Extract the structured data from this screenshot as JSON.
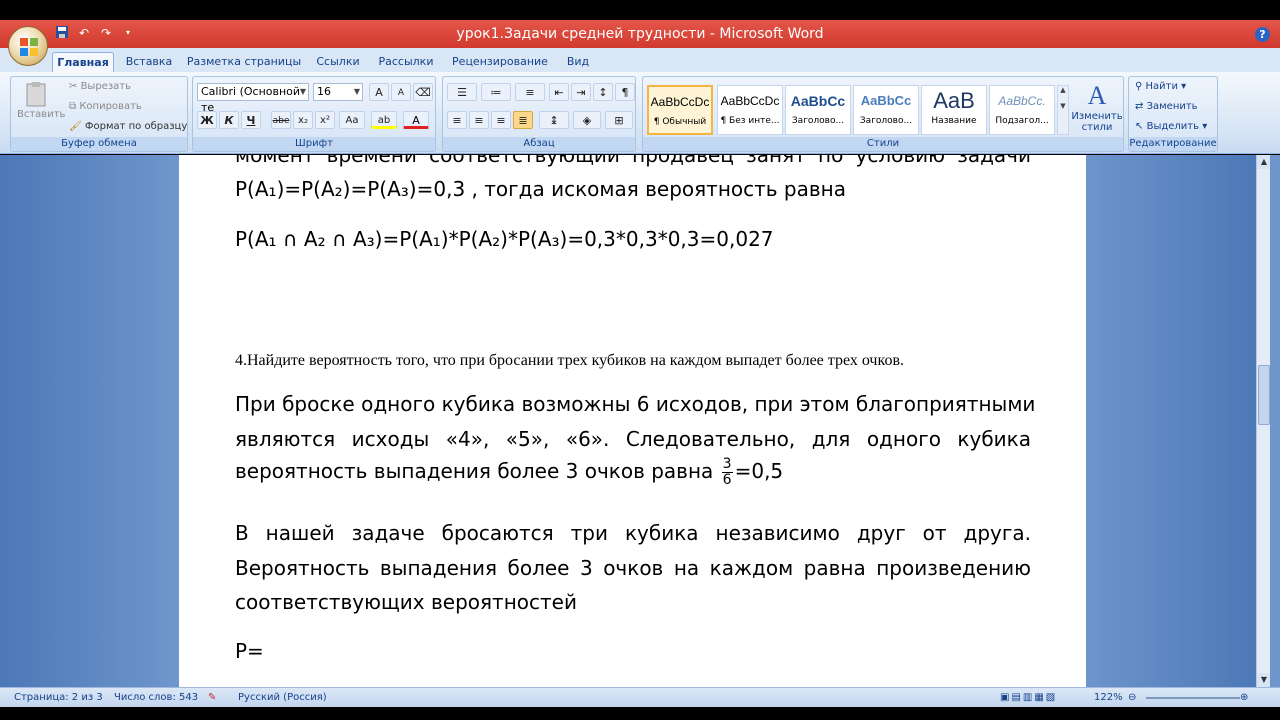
{
  "window": {
    "title": "урок1.Задачи средней трудности - Microsoft Word",
    "help_glyph": "?",
    "qat_icons": [
      "save-icon",
      "undo-icon",
      "redo-icon",
      "customize-icon"
    ]
  },
  "tabs": [
    {
      "label": "Главная",
      "active": true
    },
    {
      "label": "Вставка"
    },
    {
      "label": "Разметка страницы"
    },
    {
      "label": "Ссылки"
    },
    {
      "label": "Рассылки"
    },
    {
      "label": "Рецензирование"
    },
    {
      "label": "Вид"
    }
  ],
  "ribbon": {
    "clipboard": {
      "label": "Буфер обмена",
      "paste": "Вставить",
      "cut": "Вырезать",
      "copy": "Копировать",
      "format_painter": "Формат по образцу"
    },
    "font": {
      "label": "Шрифт",
      "font_name": "Calibri (Основной те",
      "font_size": "16",
      "bold": "Ж",
      "italic": "К",
      "underline": "Ч",
      "strike": "abe",
      "subscript": "x₂",
      "superscript": "x²",
      "change_case": "Aa",
      "grow": "A",
      "shrink": "A",
      "highlight": "ab",
      "font_color": "A"
    },
    "paragraph": {
      "label": "Абзац"
    },
    "styles": {
      "label": "Стили",
      "items": [
        {
          "sample": "AaBbCcDc",
          "name": "¶ Обычный",
          "selected": true
        },
        {
          "sample": "AaBbCcDc",
          "name": "¶ Без инте..."
        },
        {
          "sample": "AaBbCc",
          "name": "Заголово..."
        },
        {
          "sample": "AaBbCc",
          "name": "Заголово..."
        },
        {
          "sample": "AaB",
          "name": "Название"
        },
        {
          "sample": "AaBbCc.",
          "name": "Подзагол..."
        }
      ],
      "change_styles": "Изменить стили"
    },
    "editing": {
      "label": "Редактирование",
      "find": "Найти",
      "replace": "Заменить",
      "select": "Выделить"
    }
  },
  "document": {
    "line_cut": "момент времени соответствующий продавец занят по условию задачи",
    "line1": "P(A₁)=P(A₂)=P(A₃)=0,3 , тогда искомая вероятность равна",
    "line2": "P(A₁ ∩ A₂ ∩ A₃)=P(A₁)*P(A₂)*P(A₃)=0,3*0,3*0,3=0,027",
    "task4": "4.Найдите вероятность того, что при бросании трех кубиков на каждом выпадет более трех очков.",
    "p1_l1": "При броске одного кубика возможны 6 исходов, при этом благоприятными",
    "p1_l2": "являются исходы «4», «5», «6». Следовательно, для одного кубика",
    "p1_l3": "вероятность выпадения более 3 очков равна",
    "frac_num": "3",
    "frac_den": "6",
    "p1_l3_end": "=0,5",
    "p2_l1": "В нашей задаче бросаются три кубика независимо друг от друга.",
    "p2_l2": "Вероятность выпадения более 3 очков на каждом равна произведению",
    "p2_l3": "соответствующих вероятностей",
    "p3": "P="
  },
  "status": {
    "page": "Страница: 2 из 3",
    "words": "Число слов: 543",
    "language": "Русский (Россия)",
    "zoom": "122%"
  }
}
